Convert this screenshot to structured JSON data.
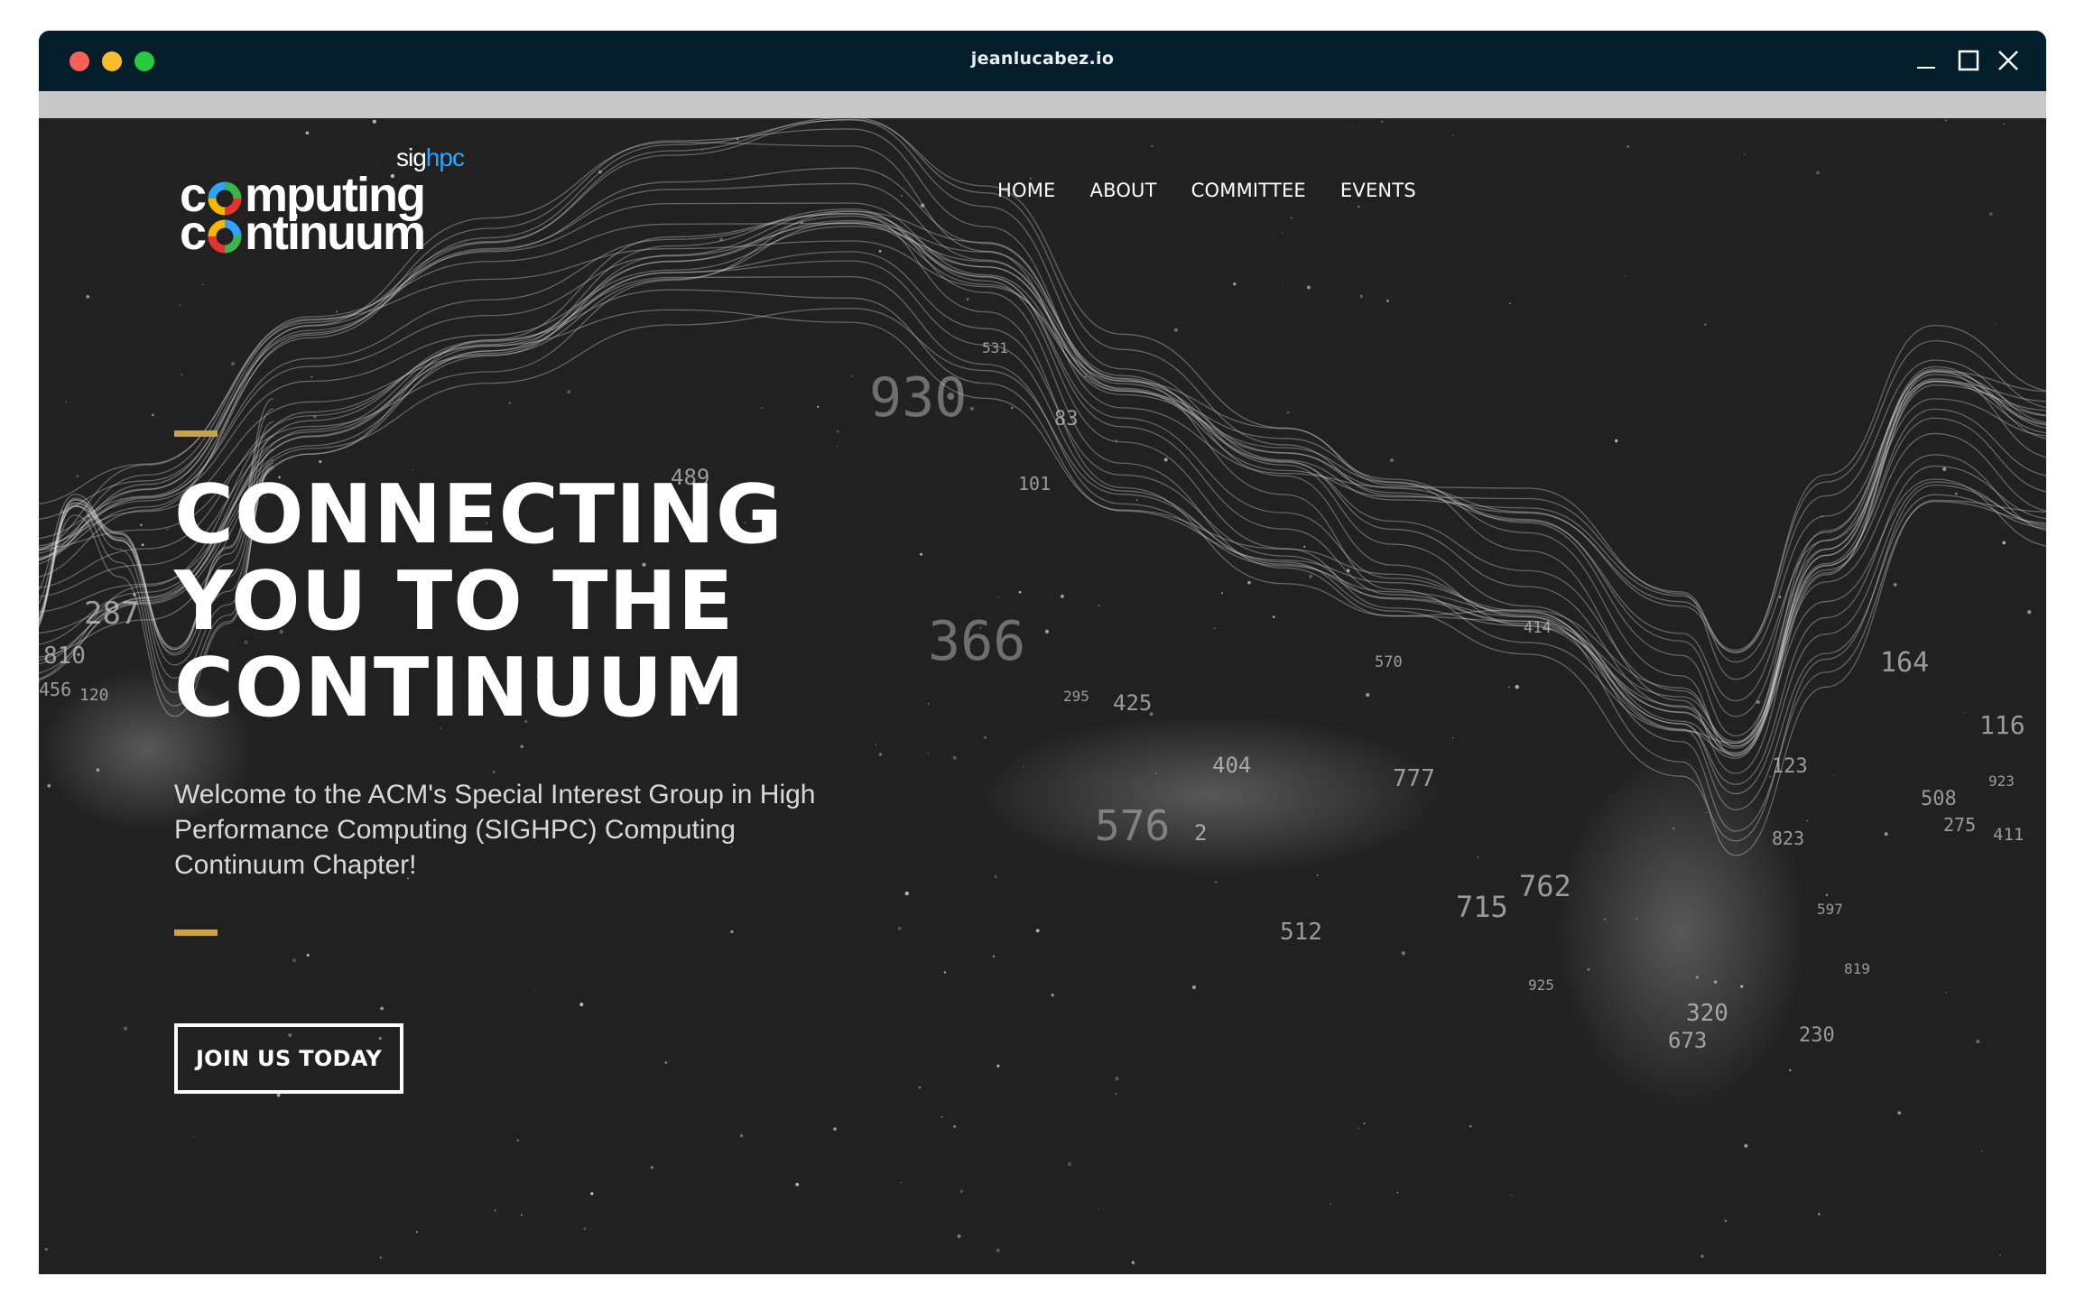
{
  "window": {
    "title": "jeanlucabez.io"
  },
  "logo": {
    "sig": "sig",
    "hpc": "hpc",
    "line1_pre": "c",
    "line1_post": "mputing",
    "line2_pre": "c",
    "line2_post": "ntinuum"
  },
  "nav": {
    "items": [
      {
        "label": "HOME"
      },
      {
        "label": "ABOUT"
      },
      {
        "label": "COMMITTEE"
      },
      {
        "label": "EVENTS"
      }
    ]
  },
  "hero": {
    "title_line1": "CONNECTING",
    "title_line2": "YOU TO THE",
    "title_line3": "CONTINUUM",
    "subtitle": "Welcome to the ACM's Special Interest Group in High Performance Computing (SIGHPC) Computing Continuum Chapter!",
    "cta_label": "JOIN US TODAY"
  },
  "background_numbers": [
    "930",
    "366",
    "576",
    "777",
    "164",
    "116",
    "762",
    "715",
    "512",
    "320",
    "673",
    "230",
    "425",
    "404",
    "123",
    "823",
    "287",
    "810",
    "456",
    "120",
    "83",
    "101",
    "489",
    "414",
    "570",
    "411",
    "508",
    "275",
    "923",
    "597",
    "819",
    "925",
    "295",
    "531",
    "2"
  ],
  "colors": {
    "accent": "#c9a24a",
    "titlebar": "#041e2c",
    "page_bg": "#212121"
  }
}
